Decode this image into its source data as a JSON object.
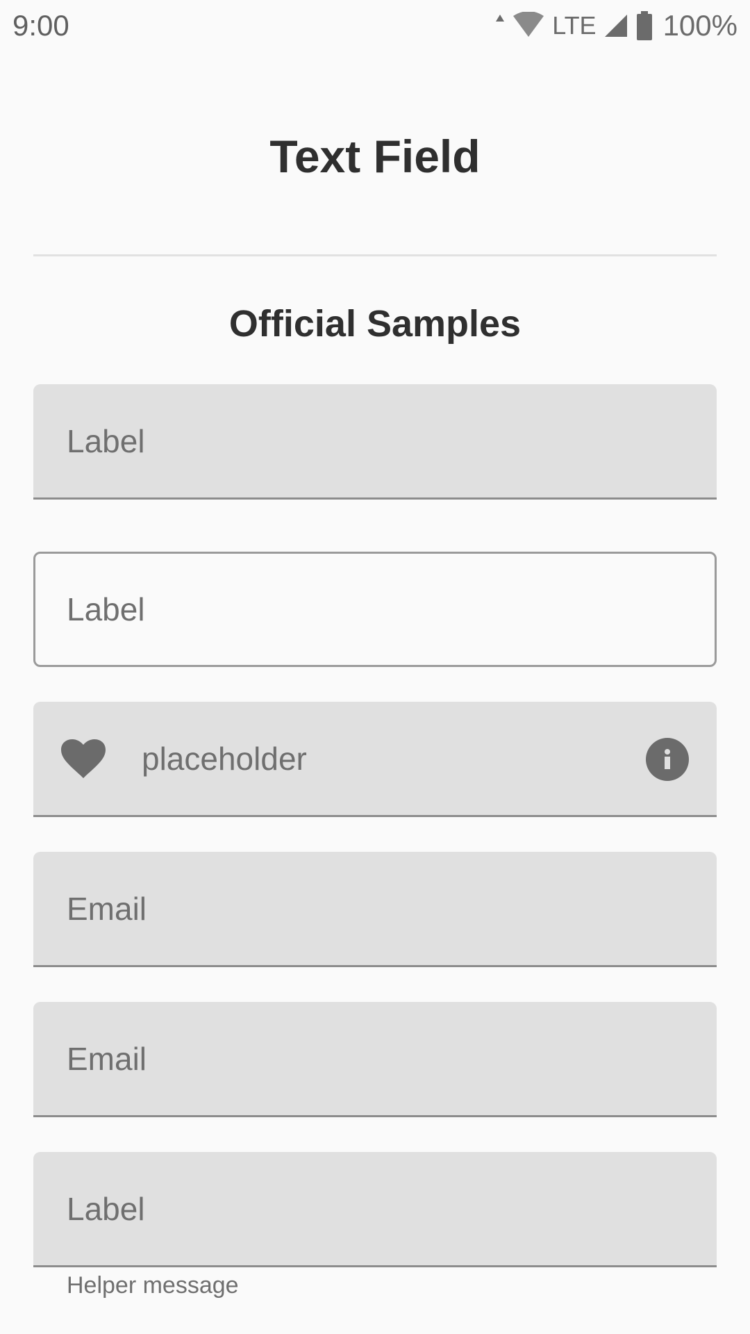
{
  "status_bar": {
    "time": "9:00",
    "network": "LTE",
    "battery": "100%",
    "icons": [
      "data-activity-icon",
      "wifi-icon",
      "cell-signal-icon",
      "battery-icon"
    ]
  },
  "page": {
    "title": "Text Field",
    "section_title": "Official Samples"
  },
  "fields": [
    {
      "variant": "filled",
      "label": "Label"
    },
    {
      "variant": "outlined",
      "label": "Label"
    },
    {
      "variant": "filled-with-icons",
      "placeholder": "placeholder",
      "leading_icon": "heart-icon",
      "trailing_icon": "info-icon"
    },
    {
      "variant": "filled",
      "label": "Email"
    },
    {
      "variant": "filled",
      "label": "Email"
    },
    {
      "variant": "filled-with-helper",
      "label": "Label",
      "helper": "Helper message"
    }
  ],
  "colors": {
    "background": "#fafafa",
    "field_fill": "#e0e0e0",
    "text_primary": "#2f2f2f",
    "text_secondary": "#6f6f6f",
    "icon": "#6b6b6b"
  }
}
